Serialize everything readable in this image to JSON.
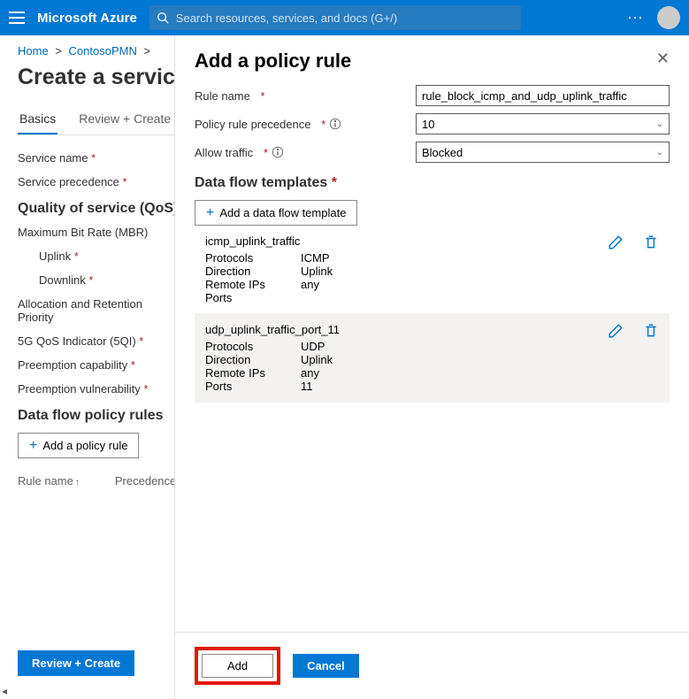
{
  "header": {
    "brand": "Microsoft Azure",
    "search_placeholder": "Search resources, services, and docs (G+/)"
  },
  "breadcrumb": {
    "home": "Home",
    "parent": "ContosoPMN"
  },
  "page_title": "Create a service",
  "tabs": {
    "basics": "Basics",
    "review": "Review + Create"
  },
  "labels": {
    "service_name": "Service name",
    "service_precedence": "Service precedence",
    "qos_heading": "Quality of service (QoS)",
    "mbr": "Maximum Bit Rate (MBR)",
    "uplink": "Uplink",
    "downlink": "Downlink",
    "arp": "Allocation and Retention Priority",
    "fiveqi": "5G QoS Indicator (5QI)",
    "preemp_cap": "Preemption capability",
    "preemp_vuln": "Preemption vulnerability",
    "policy_heading": "Data flow policy rules",
    "add_policy_rule": "Add a policy rule",
    "col_rule_name": "Rule name",
    "col_precedence": "Precedence"
  },
  "footer": {
    "review_btn": "Review + Create"
  },
  "flyout": {
    "title": "Add a policy rule",
    "rule_name_label": "Rule name",
    "rule_name_value": "rule_block_icmp_and_udp_uplink_traffic",
    "precedence_label": "Policy rule precedence",
    "precedence_value": "10",
    "allow_label": "Allow traffic",
    "allow_value": "Blocked",
    "templates_heading": "Data flow templates",
    "add_template": "Add a data flow template",
    "fields": {
      "protocols": "Protocols",
      "direction": "Direction",
      "remote_ips": "Remote IPs",
      "ports": "Ports"
    },
    "templates": [
      {
        "name": "icmp_uplink_traffic",
        "protocols": "ICMP",
        "direction": "Uplink",
        "remote_ips": "any",
        "ports": "",
        "shaded": false
      },
      {
        "name": "udp_uplink_traffic_port_11",
        "protocols": "UDP",
        "direction": "Uplink",
        "remote_ips": "any",
        "ports": "11",
        "shaded": true
      }
    ],
    "add_btn": "Add",
    "cancel_btn": "Cancel"
  }
}
